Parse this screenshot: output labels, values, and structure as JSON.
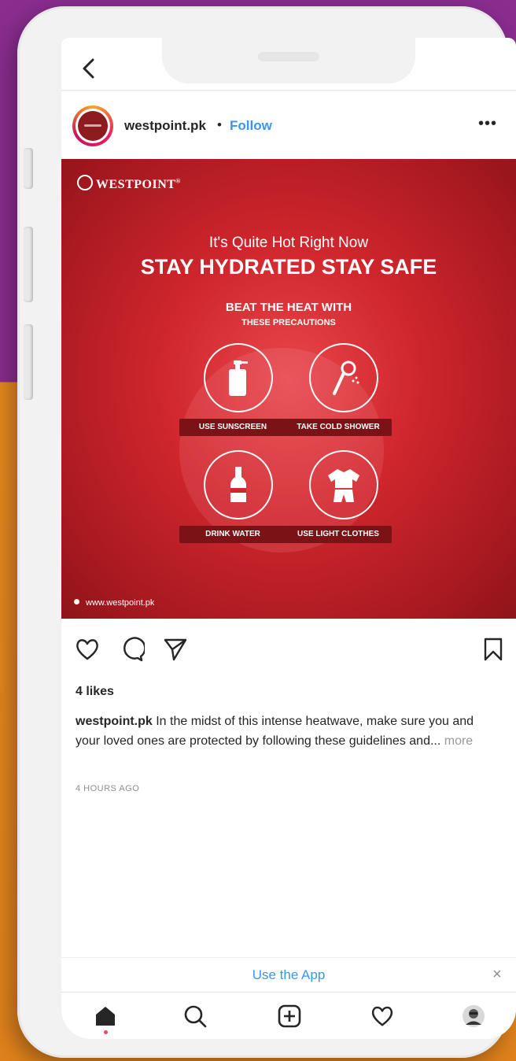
{
  "post": {
    "username": "westpoint.pk",
    "separator": "•",
    "follow_label": "Follow",
    "more_icon": "•••"
  },
  "image": {
    "brand": "WESTPOINT",
    "brand_mark": "®",
    "tagline": "It's Quite Hot Right Now",
    "headline": "STAY HYDRATED STAY SAFE",
    "beat": "BEAT THE HEAT WITH",
    "precautions": "THESE PRECAUTIONS",
    "tips": [
      "USE SUNSCREEN",
      "TAKE COLD SHOWER",
      "DRINK WATER",
      "USE LIGHT CLOTHES"
    ],
    "url": "www.westpoint.pk",
    "colors": {
      "background": "#d0262d",
      "label_bg": "#7a1216"
    }
  },
  "engagement": {
    "likes": "4 likes",
    "caption_user": "westpoint.pk",
    "caption_text": " In the midst of this intense heatwave, make sure you and your loved ones are protected by following these guidelines and...",
    "more_label": " more",
    "time": "4 HOURS AGO"
  },
  "banner": {
    "use_app": "Use the App",
    "close": "×"
  },
  "colors": {
    "link": "#3897f0",
    "notification_dot": "#ed4956"
  }
}
